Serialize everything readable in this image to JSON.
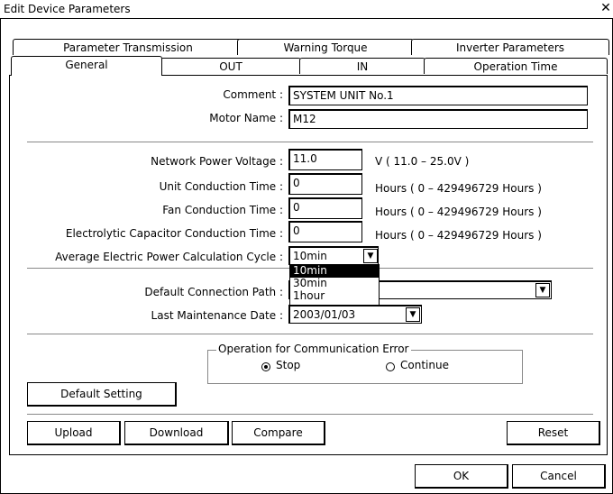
{
  "window": {
    "title": "Edit Device Parameters",
    "close_glyph": "✕"
  },
  "tabs_back": [
    "Parameter Transmission",
    "Warning Torque",
    "Inverter Parameters"
  ],
  "tabs_front": [
    "General",
    "OUT",
    "IN",
    "Operation Time"
  ],
  "fields": {
    "comment_label": "Comment :",
    "comment_value": "SYSTEM UNIT No.1",
    "motor_label": "Motor Name :",
    "motor_value": "M12",
    "voltage_label": "Network Power Voltage :",
    "voltage_value": "11.0",
    "voltage_unit": "V ( 11.0 – 25.0V )",
    "unit_time_label": "Unit Conduction Time :",
    "unit_time_value": "0",
    "unit_time_unit": "Hours ( 0 – 429496729 Hours )",
    "fan_time_label": "Fan Conduction Time :",
    "fan_time_value": "0",
    "fan_time_unit": "Hours ( 0 – 429496729 Hours )",
    "cap_time_label": "Electrolytic Capacitor Conduction Time :",
    "cap_time_value": "0",
    "cap_time_unit": "Hours ( 0 – 429496729 Hours )",
    "cycle_label": "Average Electric Power Calculation Cycle :",
    "cycle_value": "10min",
    "cycle_options": [
      "10min",
      "30min",
      "1hour"
    ],
    "path_label": "Default Connection Path :",
    "path_value": "",
    "maint_label": "Last Maintenance Date :",
    "maint_value": "2003/01/03"
  },
  "comm_error": {
    "title": "Operation for Communication Error",
    "stop": "Stop",
    "continue": "Continue",
    "selected": "Stop"
  },
  "buttons": {
    "default_setting": "Default Setting",
    "upload": "Upload",
    "download": "Download",
    "compare": "Compare",
    "reset": "Reset",
    "ok": "OK",
    "cancel": "Cancel"
  }
}
